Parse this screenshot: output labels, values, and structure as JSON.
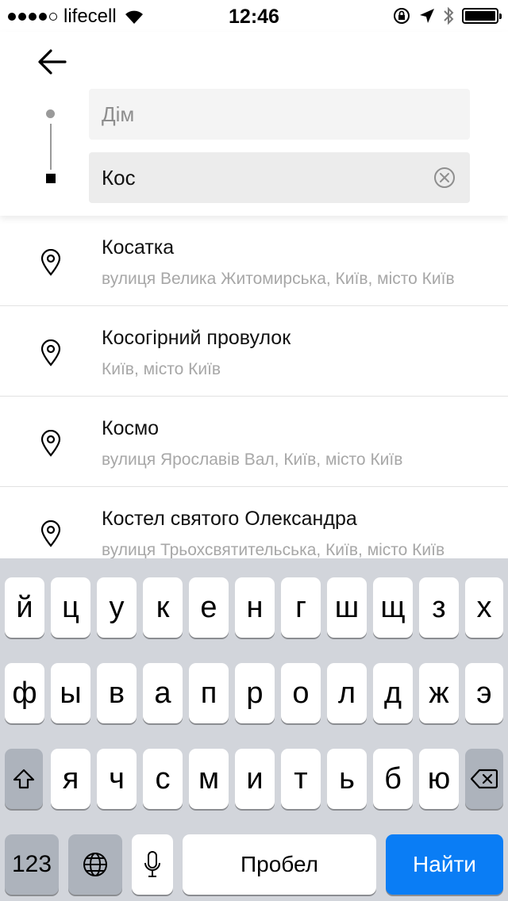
{
  "status_bar": {
    "carrier": "lifecell",
    "time": "12:46",
    "signal_bars_filled": 4,
    "signal_bars_total": 5,
    "icons": [
      "wifi-icon",
      "rotation-lock-icon",
      "location-arrow-icon",
      "bluetooth-icon",
      "battery-icon"
    ]
  },
  "header": {
    "back_icon": "arrow-left-icon",
    "from_field": {
      "value": "Дім"
    },
    "to_field": {
      "value": "Кос",
      "clear_icon": "clear-circle-icon"
    }
  },
  "results": [
    {
      "title": "Косатка",
      "subtitle": "вулиця Велика Житомирська, Київ, місто Київ",
      "icon": "location-pin-icon"
    },
    {
      "title": "Косогірний провулок",
      "subtitle": "Київ, місто Київ",
      "icon": "location-pin-icon"
    },
    {
      "title": "Космо",
      "subtitle": "вулиця Ярославів Вал, Київ, місто Київ",
      "icon": "location-pin-icon"
    },
    {
      "title": "Костел святого Олександра",
      "subtitle": "вулиця Трьохсвятительська, Київ, місто Київ",
      "icon": "location-pin-icon"
    }
  ],
  "keyboard": {
    "row1": [
      "й",
      "ц",
      "у",
      "к",
      "е",
      "н",
      "г",
      "ш",
      "щ",
      "з",
      "х"
    ],
    "row2": [
      "ф",
      "ы",
      "в",
      "а",
      "п",
      "р",
      "о",
      "л",
      "д",
      "ж",
      "э"
    ],
    "row3": [
      "я",
      "ч",
      "с",
      "м",
      "и",
      "т",
      "ь",
      "б",
      "ю"
    ],
    "numbers_label": "123",
    "space_label": "Пробел",
    "action_label": "Найти",
    "shift_icon": "shift-icon",
    "backspace_icon": "backspace-icon",
    "globe_icon": "globe-icon",
    "mic_icon": "microphone-icon"
  },
  "colors": {
    "action_blue": "#0a7df5",
    "keyboard_bg": "#d2d5db",
    "dark_key": "#adb3bc",
    "subtitle_gray": "#a7a7a7"
  }
}
